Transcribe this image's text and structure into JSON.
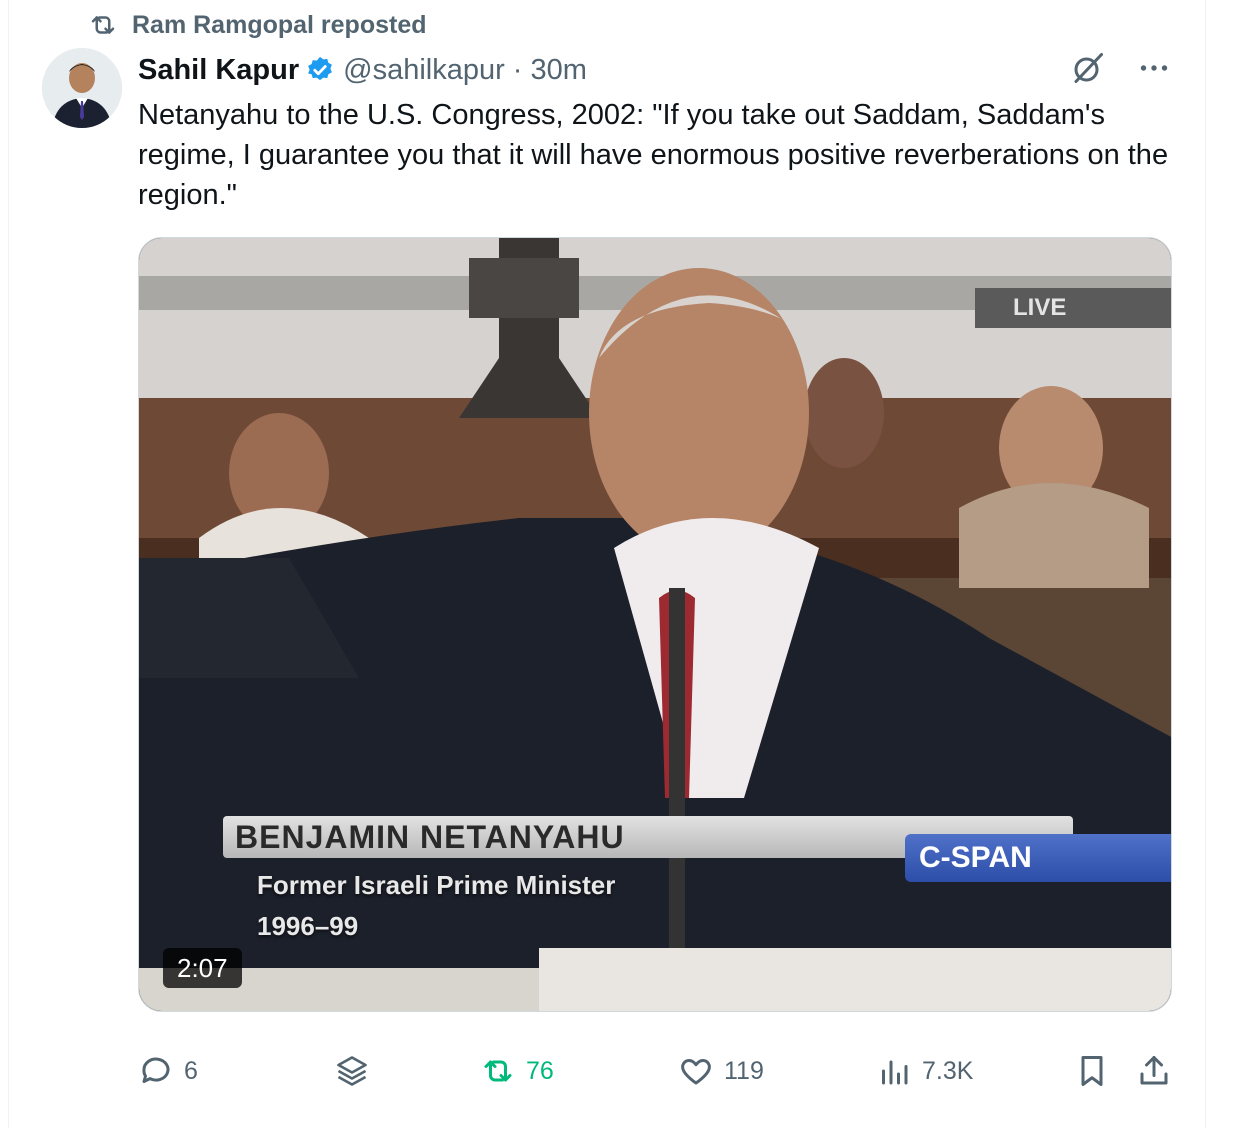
{
  "repost_banner": {
    "text": "Ram Ramgopal reposted"
  },
  "tweet": {
    "author_name": "Sahil Kapur",
    "handle": "@sahilkapur",
    "separator": "·",
    "time": "30m",
    "text": "Netanyahu to the U.S. Congress, 2002: \"If you take out Saddam, Saddam's regime, I guarantee you that it will have enormous positive reverberations on the region.\""
  },
  "video": {
    "live_tag": "LIVE",
    "name_caption": "BENJAMIN NETANYAHU",
    "network": "C-SPAN",
    "subtitle": "Former Israeli Prime Minister",
    "years": "1996–99",
    "duration": "2:07"
  },
  "actions": {
    "replies": "6",
    "reposts": "76",
    "likes": "119",
    "views": "7.3K"
  },
  "colors": {
    "text": "#0f1419",
    "secondary": "#536471",
    "verified": "#1d9bf0",
    "repost_active": "#00ba7c"
  },
  "icons": [
    "repost-icon",
    "verified-icon",
    "grok-icon",
    "more-icon",
    "reply-icon",
    "layers-icon",
    "like-icon",
    "views-icon",
    "bookmark-icon",
    "share-icon"
  ]
}
